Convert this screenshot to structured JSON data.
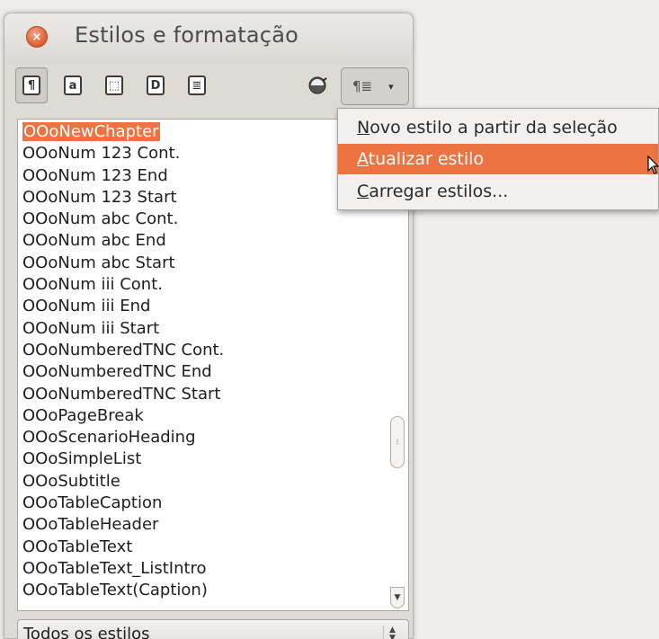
{
  "window": {
    "title": "Estilos e formatação"
  },
  "toolbar": {
    "buttons": [
      {
        "name": "paragraph-styles-icon",
        "glyph": "¶"
      },
      {
        "name": "character-styles-icon",
        "glyph": "a"
      },
      {
        "name": "frame-styles-icon",
        "glyph": "⬚"
      },
      {
        "name": "page-styles-icon",
        "glyph": "D"
      },
      {
        "name": "list-styles-icon",
        "glyph": "≣"
      }
    ],
    "new_style_button_glyph": "¶≣",
    "dropdown_arrow": "▾"
  },
  "style_list": {
    "items": [
      "OOoNewChapter",
      "OOoNum 123 Cont.",
      "OOoNum 123 End",
      "OOoNum 123 Start",
      "OOoNum abc Cont.",
      "OOoNum abc End",
      "OOoNum abc Start",
      "OOoNum iii Cont.",
      "OOoNum iii End",
      "OOoNum iii Start",
      "OOoNumberedTNC Cont.",
      "OOoNumberedTNC End",
      "OOoNumberedTNC Start",
      "OOoPageBreak",
      "OOoScenarioHeading",
      "OOoSimpleList",
      "OOoSubtitle",
      "OOoTableCaption",
      "OOoTableHeader",
      "OOoTableText",
      "OOoTableText_ListIntro",
      "OOoTableText(Caption)"
    ],
    "selected_index": 0
  },
  "filter": {
    "value": "Todos os estilos"
  },
  "menu": {
    "items": [
      {
        "first": "N",
        "rest": "ovo estilo a partir da seleção",
        "highlighted": false
      },
      {
        "first": "A",
        "rest": "tualizar estilo",
        "highlighted": true
      },
      {
        "first": "C",
        "rest": "arregar estilos...",
        "highlighted": false
      }
    ]
  },
  "colors": {
    "accent": "#ee7342",
    "panel_bg": "#dedbd7",
    "close_button": "#e05a2c"
  }
}
